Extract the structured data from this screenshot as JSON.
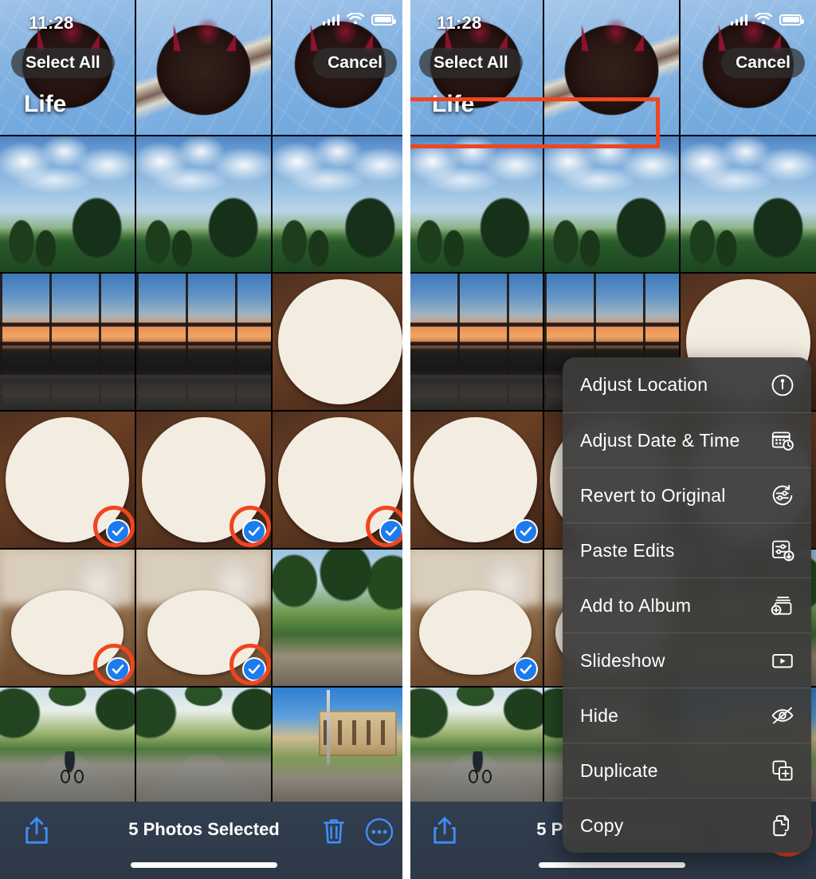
{
  "status_bar": {
    "time": "11:28",
    "signal_icon": "cellular-signal-icon",
    "wifi_icon": "wifi-icon",
    "battery_icon": "battery-full-icon"
  },
  "nav": {
    "select_all_label": "Select All",
    "cancel_label": "Cancel",
    "album_title": "Life"
  },
  "toolbar": {
    "share_icon": "share-icon",
    "selection_count_label": "5 Photos Selected",
    "trash_icon": "trash-icon",
    "more_icon": "more-ellipsis-icon"
  },
  "context_menu": {
    "items": [
      {
        "label": "Adjust Location",
        "icon": "location-pin-icon"
      },
      {
        "label": "Adjust Date & Time",
        "icon": "calendar-clock-icon"
      },
      {
        "label": "Revert to Original",
        "icon": "revert-sliders-icon"
      },
      {
        "label": "Paste Edits",
        "icon": "paste-edits-icon"
      },
      {
        "label": "Add to Album",
        "icon": "add-to-album-icon"
      },
      {
        "label": "Slideshow",
        "icon": "play-rectangle-icon"
      },
      {
        "label": "Hide",
        "icon": "eye-slash-icon"
      },
      {
        "label": "Duplicate",
        "icon": "duplicate-squares-icon"
      },
      {
        "label": "Copy",
        "icon": "copy-pages-icon"
      }
    ],
    "highlighted_item_index": 2
  },
  "annotation": {
    "highlight_color": "#f0451f",
    "check_color": "#1c7ced"
  },
  "grid": {
    "columns": 3,
    "rows": 6,
    "photos": [
      {
        "kind": "cake",
        "variant": "a",
        "selected": false
      },
      {
        "kind": "cake",
        "variant": "b",
        "selected": false
      },
      {
        "kind": "cake",
        "variant": "c",
        "selected": false
      },
      {
        "kind": "palms",
        "variant": "a",
        "selected": false
      },
      {
        "kind": "palms",
        "variant": "b",
        "selected": false
      },
      {
        "kind": "palms",
        "variant": "c",
        "selected": false
      },
      {
        "kind": "sunset",
        "variant": "a",
        "selected": false
      },
      {
        "kind": "sunset",
        "variant": "b",
        "selected": false
      },
      {
        "kind": "plate",
        "variant": "a",
        "selected": false
      },
      {
        "kind": "plate",
        "variant": "b",
        "selected": true
      },
      {
        "kind": "plate",
        "variant": "c",
        "selected": true
      },
      {
        "kind": "plate",
        "variant": "d",
        "selected": true
      },
      {
        "kind": "wood",
        "variant": "a",
        "selected": true
      },
      {
        "kind": "wood",
        "variant": "b",
        "selected": true
      },
      {
        "kind": "trees2",
        "variant": "a",
        "selected": false
      },
      {
        "kind": "cyclist",
        "variant": "a",
        "selected": false
      },
      {
        "kind": "road",
        "variant": "a",
        "selected": false
      },
      {
        "kind": "building",
        "variant": "a",
        "selected": false
      }
    ]
  },
  "panels": {
    "left_caption": "photos-grid-selection-view",
    "right_caption": "photos-grid-context-menu-view"
  }
}
